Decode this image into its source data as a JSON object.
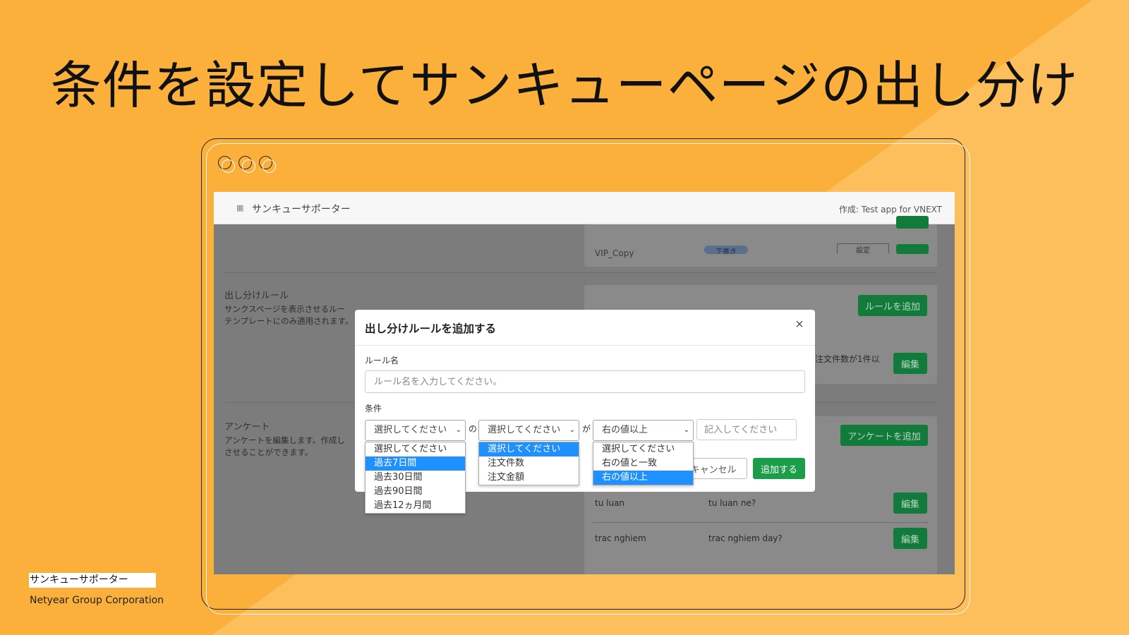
{
  "headline": "条件を設定してサンキューページの出し分け",
  "app": {
    "name": "サンキューサポーター",
    "author": "作成: Test app for VNEXT"
  },
  "background_rows": {
    "row1_name": "VIP_Copy",
    "row1_badge": "下書き",
    "row1_settings": "設定"
  },
  "rules_section": {
    "title": "出し分けルール",
    "desc_line1": "サンクスページを表示させるルー",
    "desc_line2": "テンプレートにのみ適用されます。",
    "add_button": "ルールを追加",
    "existing_rule_text": "注文件数が1件以",
    "edit_button": "編集"
  },
  "survey_section": {
    "title": "アンケート",
    "desc_line1": "アンケートを編集します。作成し",
    "desc_line2": "させることができます。",
    "add_button": "アンケートを追加",
    "rows": [
      {
        "name": "tu luan",
        "question": "tu luan ne?",
        "edit": "編集"
      },
      {
        "name": "trac nghiem",
        "question": "trac nghiem day?",
        "edit": "編集"
      }
    ]
  },
  "modal": {
    "title": "出し分けルールを追加する",
    "close": "×",
    "rule_name_label": "ルール名",
    "rule_name_placeholder": "ルール名を入力してください。",
    "condition_label": "条件",
    "select1_value": "選択してください",
    "joiner1": "の",
    "select2_value": "選択してください",
    "joiner2": "が",
    "select3_value": "右の値以上",
    "value_placeholder": "記入してください",
    "cancel_button": "キャンセル",
    "add_button": "追加する",
    "dropdown1": [
      "選択してください",
      "過去7日間",
      "過去30日間",
      "過去90日間",
      "過去12ヵ月間"
    ],
    "dropdown1_selected": "過去7日間",
    "dropdown2": [
      "選択してください",
      "注文件数",
      "注文金額"
    ],
    "dropdown2_selected": "選択してください",
    "dropdown3": [
      "選択してください",
      "右の値と一致",
      "右の値以上"
    ],
    "dropdown3_selected": "右の値以上"
  },
  "footer": {
    "product": "サンキューサポーター",
    "company": "Netyear Group Corporation"
  },
  "colors": {
    "background": "#fbb03b",
    "accent_green": "#1a9e4a",
    "highlight_blue": "#1e90ff"
  }
}
